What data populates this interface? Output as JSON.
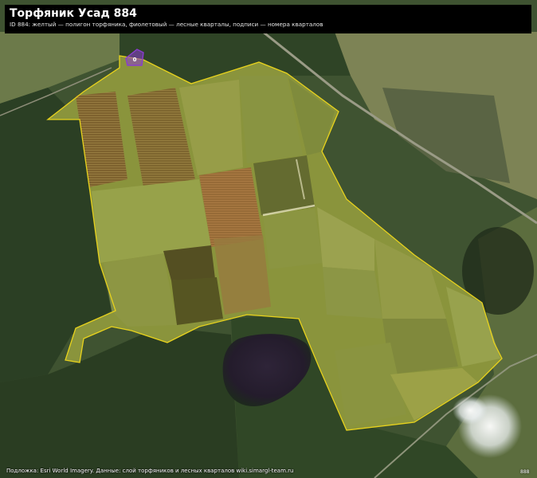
{
  "header": {
    "title": "Торфяник Усад 884",
    "subtitle": "ID 884: желтый — полигон торфяника, фиолетовый — лесные кварталы, подписи — номера кварталов"
  },
  "footer": {
    "credit": "Подложка: Esri World Imagery. Данные: слой торфяников и лесных кварталов wiki.simargl-team.ru",
    "corner_tag": "888"
  },
  "map_labels": {
    "forest_quarter_number": "0"
  },
  "colors": {
    "peat_outline": "#e8d21c",
    "peat_fill": "#c8c84a",
    "forest_quarter_outline": "#8a3ccf",
    "title_background": "#000000",
    "title_text": "#ffffff"
  },
  "icons": {
    "forest_quarter_marker": "quarter-label-icon"
  }
}
